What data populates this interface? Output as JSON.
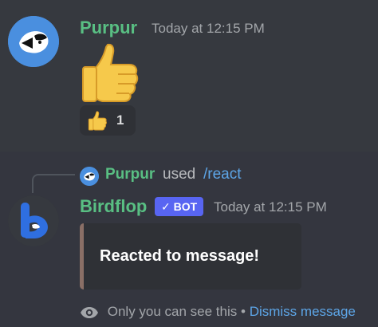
{
  "message1": {
    "username": "Purpur",
    "timestamp": "Today at 12:15 PM",
    "emoji": "thumbs-up",
    "reaction": {
      "emoji": "thumbs-up",
      "count": "1"
    }
  },
  "message2": {
    "reply": {
      "username": "Purpur",
      "used_text": "used",
      "command": "/react"
    },
    "username": "Birdflop",
    "bot_badge": "✓ BOT",
    "timestamp": "Today at 12:15 PM",
    "embed_text": "Reacted to message!",
    "ephemeral": {
      "icon": "eye-icon",
      "text": "Only you can see this",
      "separator": "•",
      "dismiss_label": "Dismiss message"
    }
  },
  "colors": {
    "background": "#36393f",
    "username": "#59bf83",
    "link": "#5da6e8",
    "bot_badge": "#5865f2",
    "embed_border": "#8a6f66"
  }
}
